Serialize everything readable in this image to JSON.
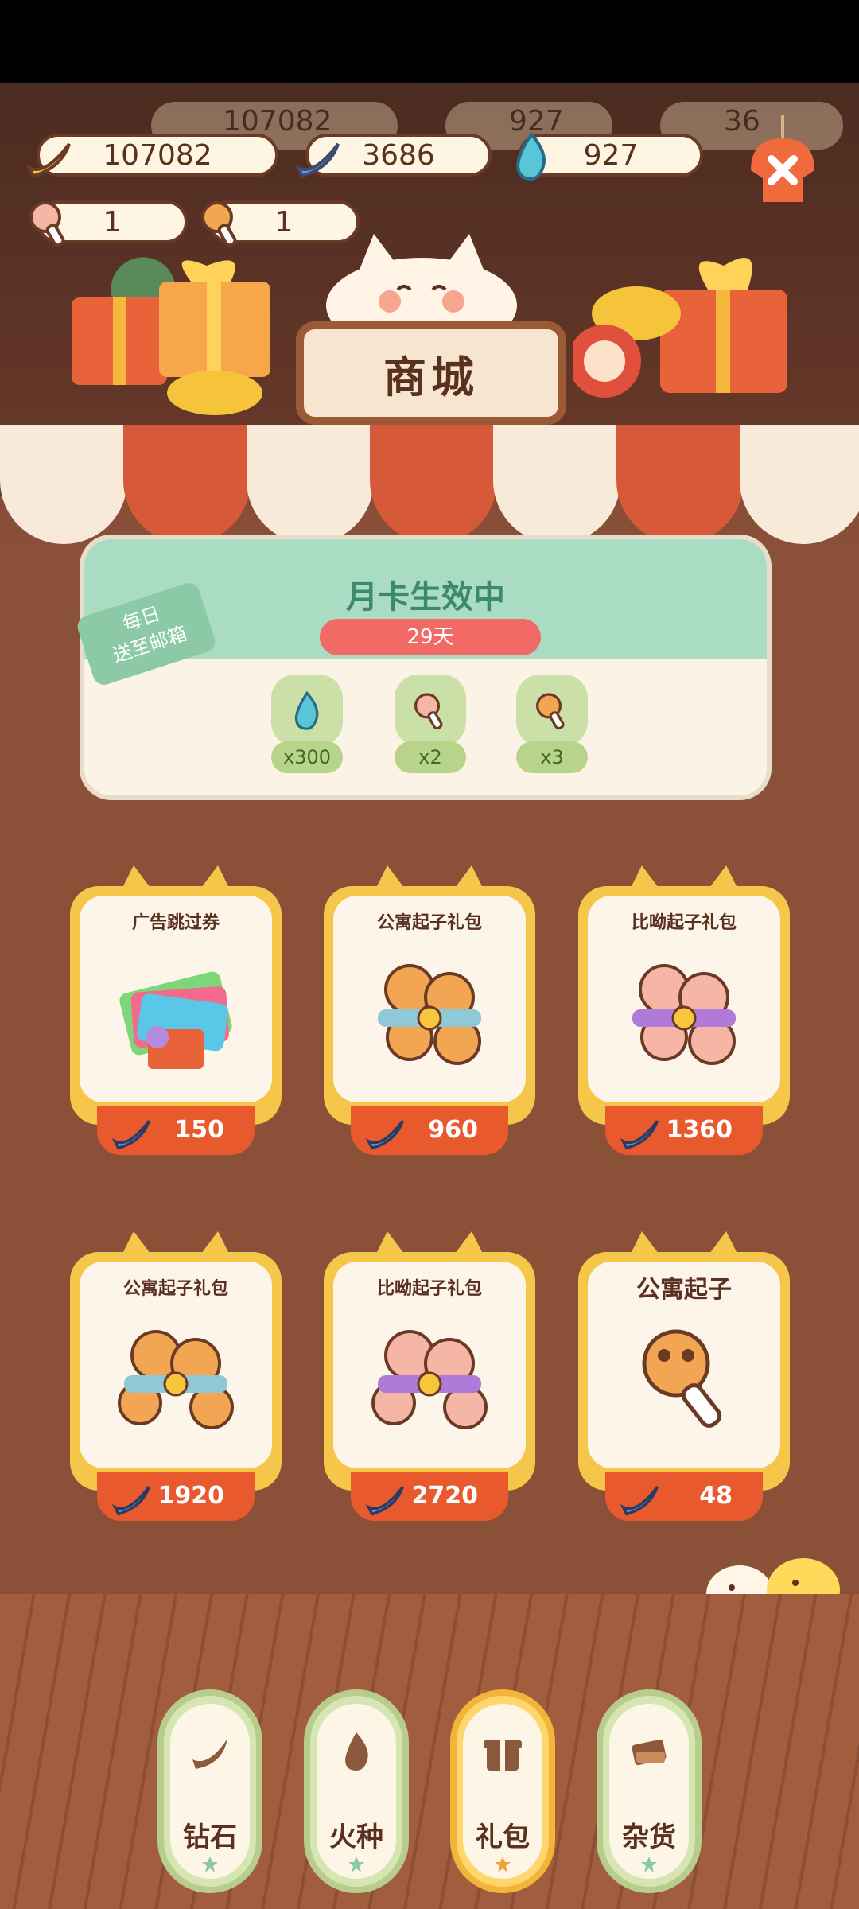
{
  "currencies": {
    "bananas": "107082",
    "blue_bananas": "3686",
    "fire": "927",
    "apartment_opener": "1",
    "biyou_opener": "1"
  },
  "ghost_values": {
    "bananas": "107082",
    "fire": "927",
    "blue_bananas": "36"
  },
  "sign": {
    "title": "商城"
  },
  "monthly_card": {
    "ribbon_line1": "每日",
    "ribbon_line2": "送至邮箱",
    "title": "月卡生效中",
    "days_left": "29天",
    "rewards": [
      {
        "icon": "blue-fire-icon",
        "qty": "x300"
      },
      {
        "icon": "pink-paw-opener-icon",
        "qty": "x2"
      },
      {
        "icon": "orange-paw-opener-icon",
        "qty": "x3"
      }
    ]
  },
  "shop_items": [
    {
      "title": "广告跳过券",
      "price": "150",
      "art": "ad-skip-ticket-icon"
    },
    {
      "title": "公寓起子礼包",
      "price": "960",
      "art": "apartment-opener-bundle-icon"
    },
    {
      "title": "比呦起子礼包",
      "price": "1360",
      "art": "biyou-opener-bundle-icon"
    },
    {
      "title": "公寓起子礼包",
      "price": "1920",
      "art": "apartment-opener-bundle-icon"
    },
    {
      "title": "比呦起子礼包",
      "price": "2720",
      "art": "biyou-opener-bundle-icon"
    },
    {
      "title": "公寓起子",
      "price": "48",
      "art": "apartment-opener-icon"
    }
  ],
  "tabs": [
    {
      "label": "钻石",
      "icon": "banana-icon",
      "active": false
    },
    {
      "label": "火种",
      "icon": "fire-icon",
      "active": false
    },
    {
      "label": "礼包",
      "icon": "gift-icon",
      "active": true
    },
    {
      "label": "杂货",
      "icon": "goods-icon",
      "active": false
    }
  ],
  "colors": {
    "background_brown": "#8b5038",
    "card_gold": "#f5c64a",
    "price_orange": "#e85a2e",
    "mint": "#a9dcc3",
    "days_red": "#f26a66"
  }
}
